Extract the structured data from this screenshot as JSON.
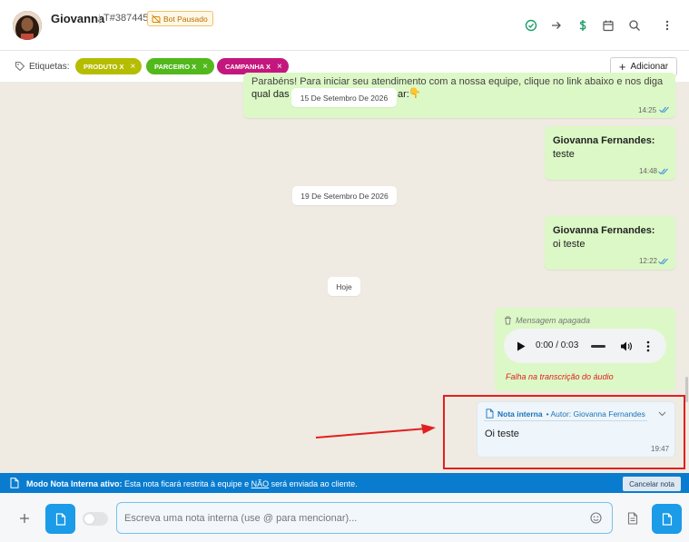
{
  "header": {
    "contact_name": "Giovanna",
    "separator": "|",
    "ticket_id": "T#387445",
    "bot_badge": "Bot Pausado",
    "icons": [
      "check-circle-icon",
      "arrow-right-icon",
      "dollar-icon",
      "calendar-icon",
      "search-icon",
      "more-vertical-icon"
    ]
  },
  "tags_bar": {
    "label": "Etiquetas:",
    "tags": [
      {
        "label": "PRODUTO X",
        "color": "#b5bd00"
      },
      {
        "label": "PARCEIRO X",
        "color": "#52b81c"
      },
      {
        "label": "CAMPANHA X",
        "color": "#c4177e"
      }
    ],
    "add_button": "Adicionar"
  },
  "chat": {
    "partial_message": {
      "line1": "Parabéns! Para iniciar seu atendimento com a nossa equipe, clique no link abaixo e nos diga",
      "line2_start": "qual das p",
      "line2_end": "ar:",
      "emoji": "👇",
      "time": "14:25"
    },
    "date_pills": [
      "15 De Setembro De 2026",
      "19 De Setembro De 2026",
      "Hoje"
    ],
    "messages": [
      {
        "sender": "Giovanna Fernandes:",
        "text": "teste",
        "time": "14:48"
      },
      {
        "sender": "Giovanna Fernandes:",
        "text": "oi teste",
        "time": "12:22"
      }
    ],
    "audio_message": {
      "deleted_label": "Mensagem apagada",
      "player_time": "0:00 / 0:03",
      "failure": "Falha na transcrição do áudio"
    },
    "internal_note": {
      "title": "Nota interna",
      "author": "• Autor: Giovanna Fernandes",
      "text": "Oi teste",
      "time": "19:47"
    }
  },
  "banner": {
    "bold": "Modo Nota Interna ativo:",
    "text_1": " Esta nota ficará restrita à equipe e ",
    "underlined": "NÃO",
    "text_2": " será enviada ao cliente.",
    "cancel_button": "Cancelar nota"
  },
  "composer": {
    "placeholder": "Escreva uma nota interna (use @ para mencionar)..."
  },
  "colors": {
    "accent_blue": "#1b9be8",
    "banner_blue": "#0a7ccf",
    "bubble_green": "#dcf8c6",
    "chat_bg": "#efeae2",
    "highlight_red": "#e02020"
  }
}
